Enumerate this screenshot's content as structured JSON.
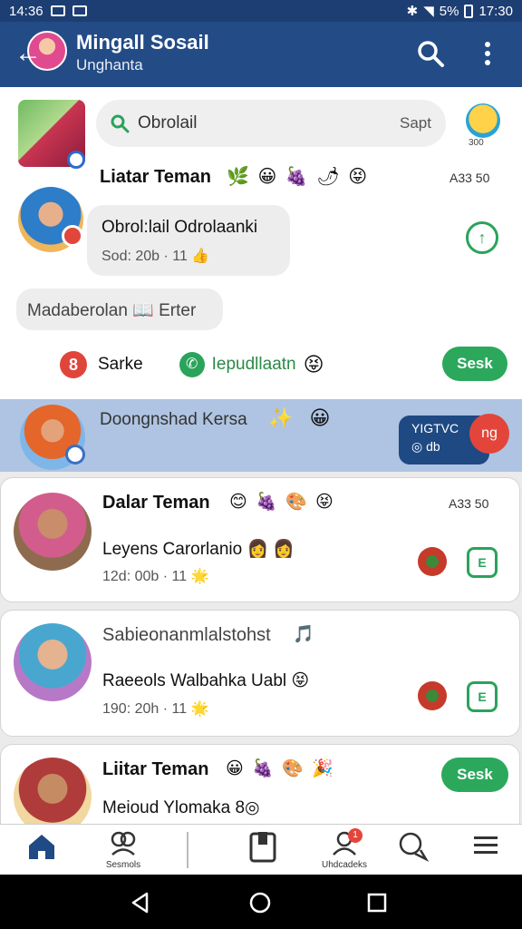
{
  "status_bar": {
    "time_left": "14:36",
    "battery": "5%",
    "time_right": "17:30"
  },
  "header": {
    "title": "Mingall Sosail",
    "subtitle": "Unghanta"
  },
  "search": {
    "placeholder": "Obrolail",
    "button": "Sapt"
  },
  "bot": {
    "label": "300"
  },
  "section": {
    "title": "Liatar Teman",
    "emojis": "🌿 😀 🍇 🌶 😝",
    "meta": "A33 50"
  },
  "bubble1": {
    "line1": "Obrol:lail Odrolaanki",
    "line2": "Sod: 20b · 11 👍"
  },
  "bubble2": {
    "text": "Madaberolan 📖 Erter"
  },
  "actions": {
    "badge": "8",
    "label1": "Sarke",
    "label2": "Iepudllaatn",
    "emoji": "😝",
    "button": "Sesk"
  },
  "highlight": {
    "text": "Doongnshad Kersa",
    "emojis": "✨ 😀",
    "card_line1": "YIGTVC",
    "card_line2": "◎ db",
    "red_label": "ng"
  },
  "cards": [
    {
      "name": "Dalar Teman",
      "emojis": "😊 🍇 🎨 😝",
      "meta": "A33 50",
      "message": "Leyens Carorlanio 👩 👩",
      "time": "12d: 00b · 11 🌟",
      "square_icon": "E"
    },
    {
      "name": "Sabieonanmlalstohst",
      "emojis": "🎵",
      "message": "Raeeols Walbahka Uabl 😝",
      "time": "190: 20h · 11 🌟",
      "square_icon": "E"
    },
    {
      "name": "Liitar Teman",
      "emojis": "😀 🍇 🎨 🎉",
      "message": "Meioud Ylomaka 8◎",
      "button": "Sesk"
    }
  ],
  "nav": {
    "tab2": "Sesmols",
    "tab5": "Uhdcadeks",
    "badge": "1"
  },
  "colors": {
    "appbar": "#234b86",
    "statusbar": "#1d3e73",
    "accent_green": "#2ba85c",
    "accent_red": "#e4453a",
    "highlight": "#aec4e2"
  }
}
